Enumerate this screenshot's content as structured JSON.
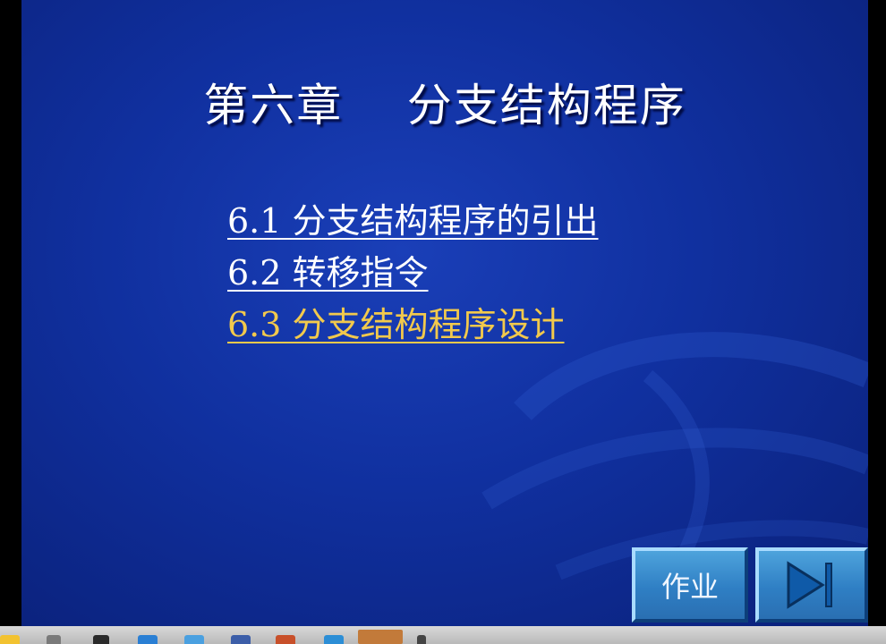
{
  "slide": {
    "title": "第六章    分支结构程序",
    "items": [
      {
        "label": "6.1 分支结构程序的引出",
        "color": "#ffffff"
      },
      {
        "label": "6.2 转移指令",
        "color": "#ffffff"
      },
      {
        "label": "6.3 分支结构程序设计",
        "color": "#f2c94c"
      }
    ]
  },
  "nav": {
    "homework_label": "作业",
    "next_icon": "play-skip-icon"
  },
  "colors": {
    "background": "#10309f",
    "button": "#2f7fc4",
    "highlight_link": "#f2c94c"
  },
  "taskbar": {
    "icons": [
      "folder-icon",
      "recycle-icon",
      "shield-icon",
      "browser-icon",
      "globe-icon",
      "mail-icon",
      "ocr-icon",
      "ie-icon",
      "media-icon",
      "app-icon"
    ]
  }
}
